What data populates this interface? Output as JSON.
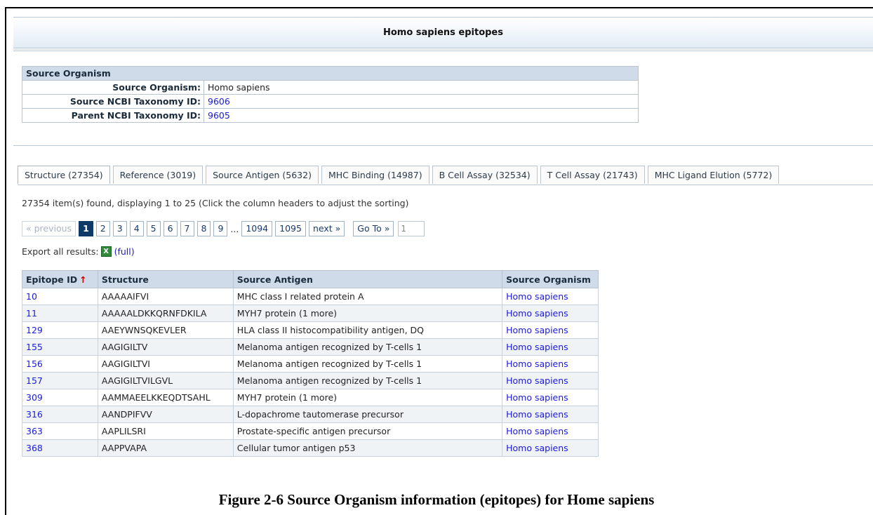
{
  "title": "Homo sapiens epitopes",
  "source_organism_table": {
    "header": "Source Organism",
    "rows": [
      {
        "label": "Source Organism:",
        "value": "Homo sapiens"
      },
      {
        "label": "Source NCBI Taxonomy ID:",
        "value": "9606"
      },
      {
        "label": "Parent NCBI Taxonomy ID:",
        "value": "9605"
      }
    ]
  },
  "tabs": [
    "Structure (27354)",
    "Reference (3019)",
    "Source Antigen (5632)",
    "MHC Binding (14987)",
    "B Cell Assay (32534)",
    "T Cell Assay (21743)",
    "MHC Ligand Elution (5772)"
  ],
  "found_text": "27354 item(s) found, displaying 1 to 25 (Click the column headers to adjust the sorting)",
  "pager": {
    "previous": "« previous",
    "pages": [
      "1",
      "2",
      "3",
      "4",
      "5",
      "6",
      "7",
      "8",
      "9"
    ],
    "ellipsis": "...",
    "last_pages": [
      "1094",
      "1095"
    ],
    "next": "next »",
    "goto": "Go To »",
    "goto_value": "1"
  },
  "export": {
    "label": "Export all results:",
    "icon": "excel-icon",
    "full": "(full)"
  },
  "results": {
    "headers": [
      "Epitope ID",
      "Structure",
      "Source Antigen",
      "Source Organism"
    ],
    "sort_indicator": "↑",
    "rows": [
      [
        "10",
        "AAAAAIFVI",
        "MHC class I related protein A",
        "Homo sapiens"
      ],
      [
        "11",
        "AAAAALDKKQRNFDKILA",
        "MYH7 protein (1 more)",
        "Homo sapiens"
      ],
      [
        "129",
        "AAEYWNSQKEVLER",
        "HLA class II histocompatibility antigen, DQ",
        "Homo sapiens"
      ],
      [
        "155",
        "AAGIGILTV",
        "Melanoma antigen recognized by T-cells 1",
        "Homo sapiens"
      ],
      [
        "156",
        "AAGIGILTVI",
        "Melanoma antigen recognized by T-cells 1",
        "Homo sapiens"
      ],
      [
        "157",
        "AAGIGILTVILGVL",
        "Melanoma antigen recognized by T-cells 1",
        "Homo sapiens"
      ],
      [
        "309",
        "AAMMAEELKKEQDTSAHL",
        "MYH7 protein (1 more)",
        "Homo sapiens"
      ],
      [
        "316",
        "AANDPIFVV",
        "L-dopachrome tautomerase precursor",
        "Homo sapiens"
      ],
      [
        "363",
        "AAPLILSRI",
        "Prostate-specific antigen precursor",
        "Homo sapiens"
      ],
      [
        "368",
        "AAPPVAPA",
        "Cellular tumor antigen p53",
        "Homo sapiens"
      ]
    ]
  },
  "caption": "Figure 2-6  Source Organism information (epitopes) for Home sapiens"
}
